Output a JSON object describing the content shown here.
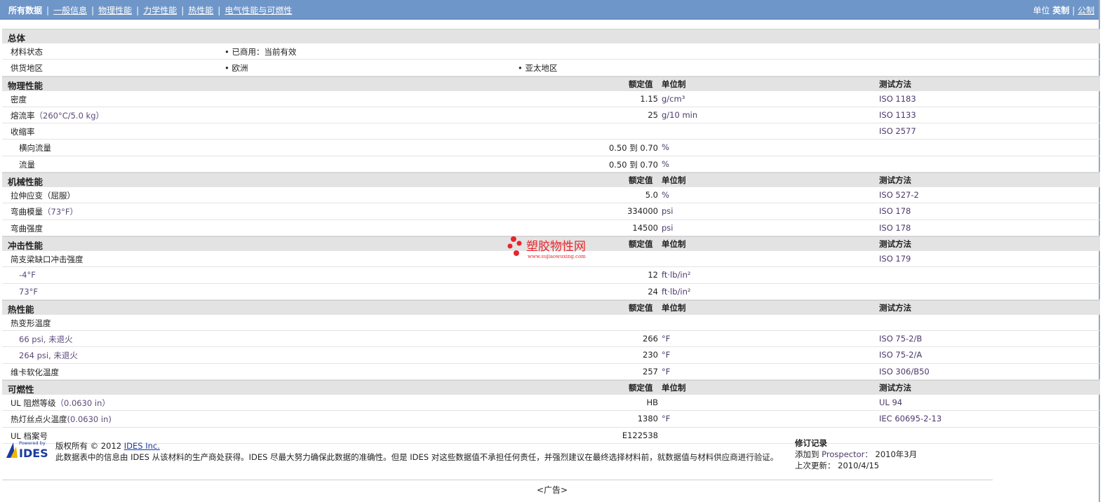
{
  "nav": {
    "items": [
      "所有数据",
      "一般信息",
      "物理性能",
      "力学性能",
      "热性能",
      "电气性能与可燃性"
    ]
  },
  "units": {
    "label": "单位",
    "english": "英制",
    "metric": "公制"
  },
  "sections": [
    {
      "title": "总体",
      "header": false,
      "rows": [
        {
          "label": "材料状态",
          "bullets": [
            "已商用：当前有效"
          ]
        },
        {
          "label": "供货地区",
          "bullets": [
            "欧洲",
            "亚太地区"
          ]
        }
      ]
    },
    {
      "title": "物理性能",
      "header": true,
      "rows": [
        {
          "label": "密度",
          "value": "1.15",
          "unit": "g/cm³",
          "method": "ISO 1183"
        },
        {
          "label": "熔流率",
          "cond": "（260°C/5.0 kg）",
          "value": "25",
          "unit": "g/10 min",
          "method": "ISO 1133"
        },
        {
          "label": "收缩率",
          "method": "ISO 2577"
        },
        {
          "label": "横向流量",
          "indent": true,
          "value": "0.50 到  0.70",
          "unit": "%"
        },
        {
          "label": "流量",
          "indent": true,
          "value": "0.50 到  0.70",
          "unit": "%"
        }
      ]
    },
    {
      "title": "机械性能",
      "header": true,
      "rows": [
        {
          "label": "拉伸应变（屈服）",
          "value": "5.0",
          "unit": "%",
          "method": "ISO 527-2"
        },
        {
          "label": "弯曲模量",
          "cond": "（73°F）",
          "value": "334000",
          "unit": "psi",
          "method": "ISO 178"
        },
        {
          "label": "弯曲强度",
          "value": "14500",
          "unit": "psi",
          "method": "ISO 178"
        }
      ]
    },
    {
      "title": "冲击性能",
      "header": true,
      "rows": [
        {
          "label": "简支梁缺口冲击强度",
          "method": "ISO 179"
        },
        {
          "label": "-4°F",
          "indent": true,
          "condlabel": true,
          "value": "12",
          "unit": "ft·lb/in²"
        },
        {
          "label": "73°F",
          "indent": true,
          "condlabel": true,
          "value": "24",
          "unit": "ft·lb/in²"
        }
      ]
    },
    {
      "title": "热性能",
      "header": true,
      "rows": [
        {
          "label": "热变形温度"
        },
        {
          "label": "66 psi, 未退火",
          "indent": true,
          "condlabel": true,
          "value": "266",
          "unit": "°F",
          "method": "ISO 75-2/B"
        },
        {
          "label": "264 psi, 未退火",
          "indent": true,
          "condlabel": true,
          "value": "230",
          "unit": "°F",
          "method": "ISO 75-2/A"
        },
        {
          "label": "维卡软化温度",
          "value": "257",
          "unit": "°F",
          "method": "ISO 306/B50"
        }
      ]
    },
    {
      "title": "可燃性",
      "header": true,
      "rows": [
        {
          "label": "UL 阻燃等级",
          "cond": "（0.0630 in）",
          "value": "HB",
          "method": "UL 94"
        },
        {
          "label": "热灯丝点火温度",
          "cond": "(0.0630 in)",
          "value": "1380",
          "unit": "°F",
          "method": "IEC 60695-2-13"
        },
        {
          "label": "UL 档案号",
          "value": "E122538"
        }
      ]
    }
  ],
  "col_headers": {
    "value": "额定值",
    "unit": "单位制",
    "method": "测试方法"
  },
  "footer": {
    "logo_top": "Powered by",
    "logo": "IDES",
    "copyright": "版权所有 © 2012",
    "copyright_link": "IDES Inc.",
    "disclaimer": "此数据表中的信息由  IDES 从该材料的生产商处获得。IDES 尽最大努力确保此数据的准确性。但是  IDES 对这些数据值不承担任何责任，并强烈建议在最终选择材料前，就数据值与材料供应商进行验证。",
    "rev_title": "修订记录",
    "added_label": "添加到 ",
    "added_prod": "Prospector：",
    "added_date": "2010年3月",
    "updated_label": "上次更新：",
    "updated_date": "2010/4/15"
  },
  "ad": "<广告>",
  "watermark": {
    "cn": "塑胶物性网",
    "url": "www.sujiaowuxing.com",
    "color": "#e8252b"
  }
}
